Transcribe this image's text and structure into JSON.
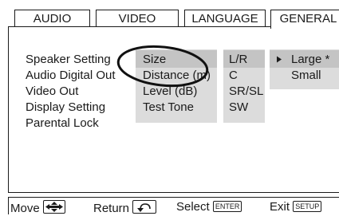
{
  "tabs": [
    {
      "label": "AUDIO",
      "active": false
    },
    {
      "label": "VIDEO",
      "active": false
    },
    {
      "label": "LANGUAGE",
      "active": false
    },
    {
      "label": "GENERAL",
      "active": true
    }
  ],
  "menu": {
    "items": [
      {
        "label": "Speaker Setting",
        "selected": true
      },
      {
        "label": "Audio Digital Out",
        "selected": false
      },
      {
        "label": "Video Out",
        "selected": false
      },
      {
        "label": "Display Setting",
        "selected": false
      },
      {
        "label": "Parental Lock",
        "selected": false
      }
    ]
  },
  "submenu": {
    "items": [
      {
        "label": "Size",
        "selected": true
      },
      {
        "label": "Distance (m)",
        "selected": false
      },
      {
        "label": "Level (dB)",
        "selected": false
      },
      {
        "label": "Test Tone",
        "selected": false
      }
    ]
  },
  "channels": {
    "items": [
      {
        "label": "L/R",
        "selected": true
      },
      {
        "label": "C",
        "selected": false
      },
      {
        "label": "SR/SL",
        "selected": false
      },
      {
        "label": "SW",
        "selected": false
      }
    ]
  },
  "options": {
    "items": [
      {
        "label": "Large *",
        "selected": true
      },
      {
        "label": "Small",
        "selected": false
      }
    ]
  },
  "statusbar": {
    "move_label": "Move",
    "return_label": "Return",
    "select_label": "Select",
    "select_key": "ENTER",
    "exit_label": "Exit",
    "exit_key": "SETUP"
  },
  "colors": {
    "column_bg": "#dcdcdc",
    "highlight_bg": "#c4c4c4",
    "text": "#1a1a1a"
  }
}
